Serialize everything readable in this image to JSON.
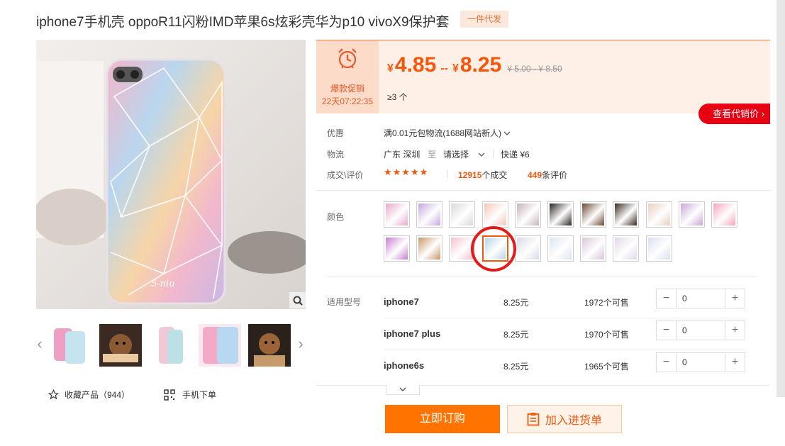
{
  "product": {
    "title": "iphone7手机壳 oppoR11闪粉IMD苹果6s炫彩壳华为p10 vivoX9保护套",
    "badge": "一件代发"
  },
  "gallery": {
    "main_image_label": "5-niu",
    "thumbnails": [
      "pink-glitter-case",
      "bear-case",
      "star-glitter-case",
      "geometric-case",
      "bear-case-2"
    ]
  },
  "actions_left": {
    "favorite_label": "收藏产品（944）",
    "mobile_order_label": "手机下单"
  },
  "promo": {
    "label": "爆款促销",
    "countdown": "22天07:22:35"
  },
  "price": {
    "currency": "¥",
    "low": "4.85",
    "dash": "--",
    "high": "8.25",
    "original": "¥ 5.00 - ¥ 8.50",
    "min_qty": "≥3 个",
    "agent_button": "查看代销价 ›"
  },
  "info": {
    "discount_label": "优惠",
    "discount_value": "满0.01元包物流(1688网站新人)",
    "logistics_label": "物流",
    "origin": "广东 深圳",
    "to": "至",
    "destination": "请选择",
    "shipping": "快递 ¥6",
    "rating_label": "成交\\评价",
    "stars": "★★★★★",
    "deals_count": "12915",
    "deals_suffix": "个成交",
    "reviews_count": "449",
    "reviews_suffix": "条评价"
  },
  "colors": {
    "label": "颜色",
    "swatches": [
      "#e9a8cf",
      "#c6a6e0",
      "#d8d8de",
      "#f3c7b8",
      "#c7b3ba",
      "#2a2320",
      "#6b4a32",
      "#3a2a22",
      "#e8cfc0",
      "#c9a6d6",
      "#f4a6b9",
      "#c77fd2",
      "#c99766",
      "#f3c2cf",
      "#b9d3e6",
      "#d7dbe8",
      "#d9e4f0",
      "#d9c5d9",
      "#e3d6e8",
      "#d7e0ee"
    ],
    "selected_index": 14
  },
  "models": {
    "label": "适用型号",
    "rows": [
      {
        "name": "iphone7",
        "price": "8.25元",
        "stock": "1972个可售",
        "qty": "0"
      },
      {
        "name": "iphone7 plus",
        "price": "8.25元",
        "stock": "1970个可售",
        "qty": "0"
      },
      {
        "name": "iphone6s",
        "price": "8.25元",
        "stock": "1965个可售",
        "qty": "0"
      }
    ],
    "minus": "−",
    "plus": "+"
  },
  "buttons": {
    "buy_now": "立即订购",
    "add_to_list": "加入进货单"
  }
}
